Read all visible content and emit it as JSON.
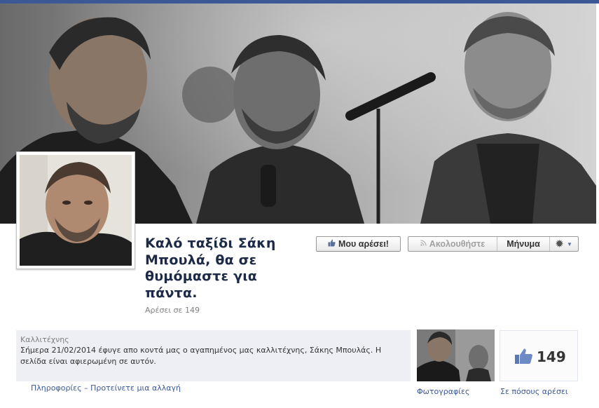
{
  "page": {
    "name": "Καλό ταξίδι Σάκη Μπουλά, θα σε θυμόμαστε για πάντα.",
    "likes_line": "Αρέσει σε 149"
  },
  "actions": {
    "like_label": "Μου αρέσει!",
    "follow_label": "Ακολουθήστε",
    "message_label": "Μήνυμα"
  },
  "about": {
    "category": "Καλλιτέχνης",
    "description": "Σήμερα 21/02/2014 έφυγε απο κοντά μας ο αγαπημένος μας καλλιτέχνης, Σάκης Μπουλάς. Η σελίδα είναι αφιερωμένη σε αυτόν.",
    "info_link": "Πληροφορίες",
    "separator": "–",
    "suggest_link": "Προτείνετε μια αλλαγή"
  },
  "tiles": {
    "photos_label": "Φωτογραφίες",
    "likes_count": "149",
    "likes_label": "Σε πόσους αρέσει"
  },
  "colors": {
    "facebook_blue": "#3b5998",
    "page_name": "#1c2a47",
    "about_bg": "#edeff4"
  },
  "icons": {
    "like_button": "thumbs-up-icon",
    "follow_button": "rss-icon",
    "settings": "gear-icon",
    "dropdown": "caret-down-icon",
    "likes_tile": "thumbs-up-icon"
  }
}
